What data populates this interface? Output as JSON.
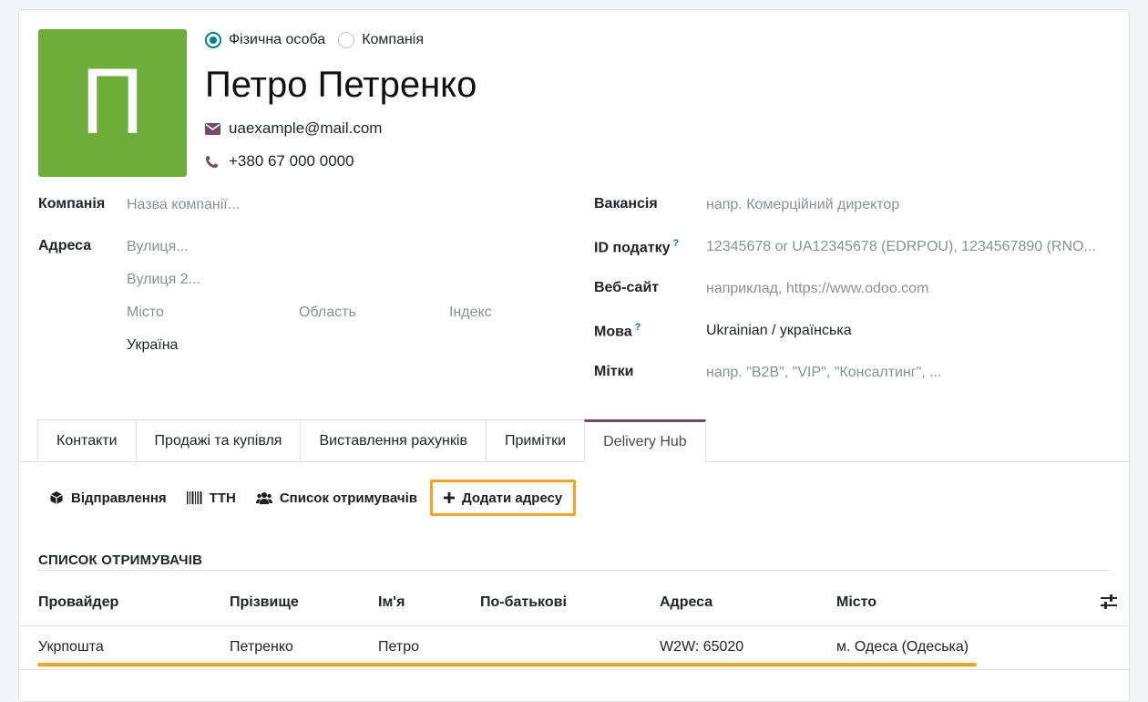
{
  "avatar": {
    "initial": "П",
    "color": "#6ead3a"
  },
  "partner_type": {
    "options": [
      "Фізична особа",
      "Компанія"
    ],
    "selected": "Фізична особа"
  },
  "partner": {
    "name": "Петро Петренко",
    "email": "uaexample@mail.com",
    "phone": "+380 67 000 0000"
  },
  "left_fields": {
    "company_label": "Компанія",
    "company_placeholder": "Назва компанії...",
    "address_label": "Адреса",
    "street_placeholder": "Вулиця...",
    "street2_placeholder": "Вулиця 2...",
    "city_placeholder": "Місто",
    "state_placeholder": "Область",
    "zip_placeholder": "Індекс",
    "country": "Україна"
  },
  "right_fields": {
    "job_label": "Вакансія",
    "job_placeholder": "напр. Комерційний директор",
    "vat_label": "ID податку",
    "vat_placeholder": "12345678 or UA12345678 (EDRPOU), 1234567890 (RNO...",
    "website_label": "Веб-сайт",
    "website_placeholder": "наприклад, https://www.odoo.com",
    "lang_label": "Мова",
    "lang_value": "Ukrainian / українська",
    "tags_label": "Мітки",
    "tags_placeholder": "напр. \"B2B\", \"VIP\", \"Консалтинг\", ...",
    "help_mark": "?"
  },
  "tabs": [
    "Контакти",
    "Продажі та купівля",
    "Виставлення рахунків",
    "Примітки",
    "Delivery Hub"
  ],
  "active_tab": "Delivery Hub",
  "actions": {
    "shipments": "Відправлення",
    "ttn": "ТТН",
    "recipients": "Список отримувачів",
    "add_address": "Додати адресу"
  },
  "recipients": {
    "title": "СПИСОК ОТРИМУВАЧІВ",
    "columns": [
      "Провайдер",
      "Прізвище",
      "Ім'я",
      "По-батькові",
      "Адреса",
      "Місто"
    ],
    "rows": [
      {
        "provider": "Укрпошта",
        "last_name": "Петренко",
        "first_name": "Петро",
        "patronymic": "",
        "address": "W2W: 65020",
        "city": "м. Одеса (Одеська)"
      }
    ]
  },
  "colors": {
    "accent": "#017e84",
    "highlight": "#f7a41c",
    "brand": "#714b67"
  }
}
